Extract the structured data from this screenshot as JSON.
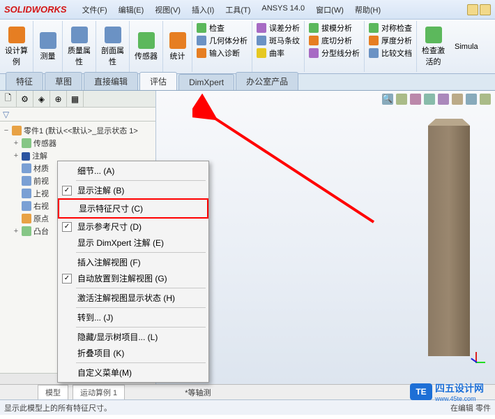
{
  "titlebar": {
    "logo": "SOLIDWORKS",
    "menus": [
      "文件(F)",
      "编辑(E)",
      "视图(V)",
      "插入(I)",
      "工具(T)",
      "ANSYS 14.0",
      "窗口(W)",
      "帮助(H)"
    ]
  },
  "ribbon": {
    "big": [
      {
        "label1": "设计算",
        "label2": "例"
      },
      {
        "label1": "测量",
        "label2": ""
      },
      {
        "label1": "质量属",
        "label2": "性"
      },
      {
        "label1": "剖面属",
        "label2": "性"
      },
      {
        "label1": "传感器",
        "label2": ""
      },
      {
        "label1": "统计",
        "label2": ""
      }
    ],
    "col1": [
      {
        "label": "检查"
      },
      {
        "label": "几何体分析"
      },
      {
        "label": "输入诊断"
      }
    ],
    "col2": [
      {
        "label": "误差分析"
      },
      {
        "label": "斑马条纹"
      },
      {
        "label": "曲率"
      }
    ],
    "col3": [
      {
        "label": "拔模分析"
      },
      {
        "label": "底切分析"
      },
      {
        "label": "分型线分析"
      }
    ],
    "col4": [
      {
        "label": "对称检查"
      },
      {
        "label": "厚度分析"
      },
      {
        "label": "比较文档"
      }
    ],
    "right": {
      "label1": "检查激",
      "label2": "活的",
      "simula": "Simula"
    }
  },
  "tabs": [
    "特征",
    "草图",
    "直接编辑",
    "评估",
    "DimXpert",
    "办公室产品"
  ],
  "tree": {
    "root": "零件1 (默认<<默认>_显示状态 1>",
    "items": [
      "传感器",
      "注解",
      "材质",
      "前视",
      "上视",
      "右视",
      "原点",
      "凸台"
    ]
  },
  "contextMenu": {
    "items": [
      {
        "label": "细节... (A)",
        "sep": false
      },
      {
        "sep": true
      },
      {
        "label": "显示注解 (B)",
        "check": true
      },
      {
        "label": "显示特征尺寸 (C)",
        "marked": true
      },
      {
        "label": "显示参考尺寸 (D)",
        "check": true
      },
      {
        "label": "显示 DimXpert 注解 (E)"
      },
      {
        "sep": true
      },
      {
        "label": "插入注解视图 (F)"
      },
      {
        "label": "自动放置到注解视图 (G)",
        "check": true
      },
      {
        "sep": true
      },
      {
        "label": "激活注解视图显示状态 (H)"
      },
      {
        "sep": true
      },
      {
        "label": "转到... (J)"
      },
      {
        "sep": true
      },
      {
        "label": "隐藏/显示树项目... (L)"
      },
      {
        "label": "折叠项目 (K)"
      },
      {
        "sep": true
      },
      {
        "label": "自定义菜单(M)"
      }
    ]
  },
  "bottom": {
    "tabs": [
      "模型",
      "运动算例 1"
    ],
    "proj": "*等轴测"
  },
  "statusbar": {
    "left": "显示此模型上的所有特征尺寸。",
    "right": "在编辑 零件"
  },
  "watermark": {
    "logo": "TE",
    "text": "四五设计网",
    "url": "www.45te.com"
  }
}
